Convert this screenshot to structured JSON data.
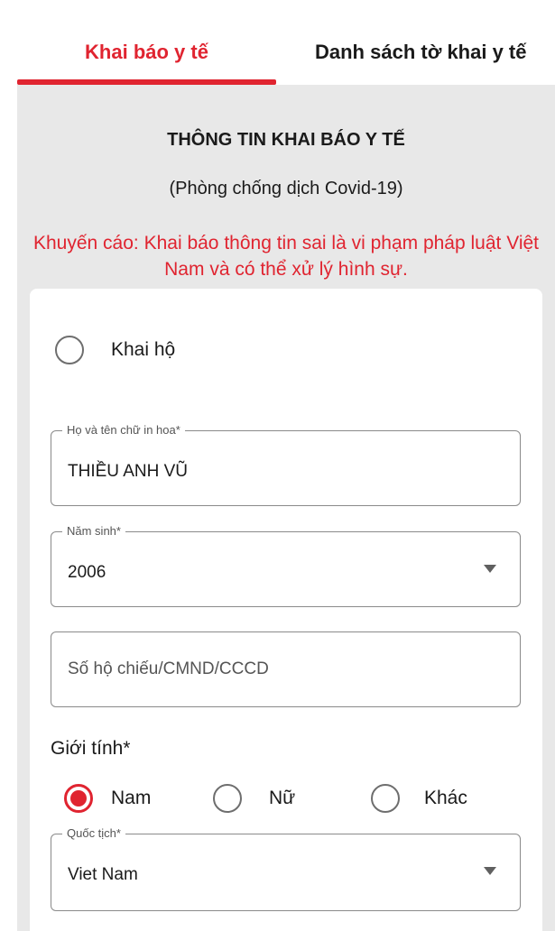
{
  "tabs": {
    "declare_label": "Khai báo y tế",
    "list_label": "Danh sách tờ khai y tế"
  },
  "header": {
    "title": "THÔNG TIN KHAI BÁO Y TẾ",
    "subtitle": "(Phòng chống dịch Covid-19)",
    "warning": "Khuyến cáo: Khai báo thông tin sai là vi phạm pháp luật Việt Nam và có thể xử lý hình sự."
  },
  "form": {
    "proxy_label": "Khai hộ",
    "proxy_checked": false,
    "full_name": {
      "label": "Họ và tên chữ in hoa*",
      "value": "THIỀU ANH VŨ"
    },
    "birth_year": {
      "label": "Năm sinh*",
      "value": "2006"
    },
    "id_number": {
      "placeholder": "Số hộ chiếu/CMND/CCCD",
      "value": ""
    },
    "gender": {
      "label": "Giới tính*",
      "options": [
        "Nam",
        "Nữ",
        "Khác"
      ],
      "selected": "Nam"
    },
    "nationality": {
      "label": "Quốc tịch*",
      "value": "Viet Nam"
    }
  },
  "colors": {
    "accent": "#e02430",
    "background": "#e8e8e8",
    "card": "#ffffff"
  },
  "icons": {
    "dropdown": "caret-down-icon",
    "radio": "radio-icon"
  }
}
